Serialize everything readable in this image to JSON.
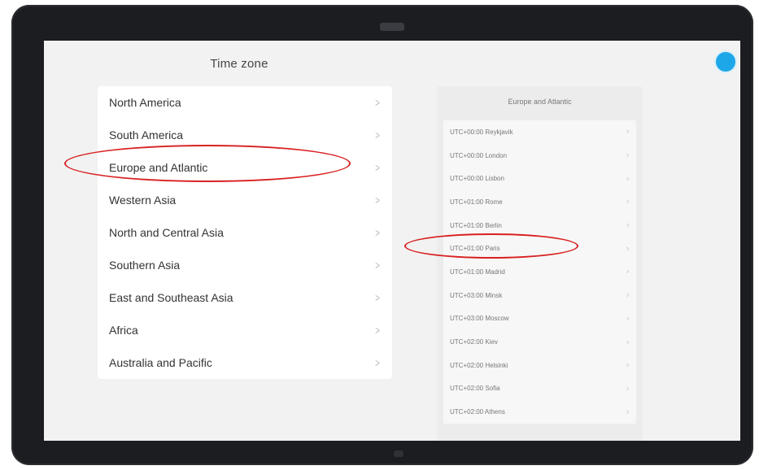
{
  "screen": {
    "title": "Time zone"
  },
  "regions": [
    {
      "label": "North America"
    },
    {
      "label": "South America"
    },
    {
      "label": "Europe and Atlantic"
    },
    {
      "label": "Western Asia"
    },
    {
      "label": "North and Central Asia"
    },
    {
      "label": "Southern Asia"
    },
    {
      "label": "East and Southeast Asia"
    },
    {
      "label": "Africa"
    },
    {
      "label": "Australia and Pacific"
    }
  ],
  "city_panel": {
    "title": "Europe and Atlantic",
    "cities": [
      {
        "label": "UTC+00:00 Reykjavik"
      },
      {
        "label": "UTC+00:00 London"
      },
      {
        "label": "UTC+00:00 Lisbon"
      },
      {
        "label": "UTC+01:00 Rome"
      },
      {
        "label": "UTC+01:00 Berlin"
      },
      {
        "label": "UTC+01:00 Paris"
      },
      {
        "label": "UTC+01:00 Madrid"
      },
      {
        "label": "UTC+03:00 Minsk"
      },
      {
        "label": "UTC+03:00 Moscow"
      },
      {
        "label": "UTC+02:00 Kiev"
      },
      {
        "label": "UTC+02:00 Helsinki"
      },
      {
        "label": "UTC+02:00 Sofia"
      },
      {
        "label": "UTC+02:00 Athens"
      }
    ]
  },
  "colors": {
    "accent": "#1ea7e8",
    "annotation": "#d92020"
  }
}
